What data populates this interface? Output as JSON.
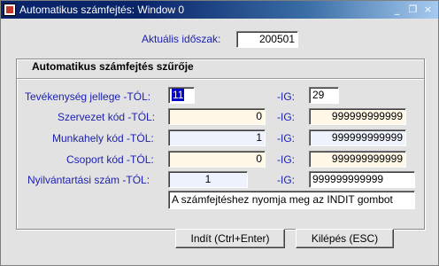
{
  "window": {
    "title": "Automatikus számfejtés: Window 0",
    "buttons": {
      "minimize": "_",
      "restore": "❐",
      "close": "×"
    }
  },
  "period": {
    "label": "Aktuális időszak:",
    "value": "200501"
  },
  "filter": {
    "title": "Automatikus számfejtés szűrője",
    "to_label": "-IG:",
    "rows": [
      {
        "label": "Tevékenység jellege -TÓL:",
        "from": "11",
        "to": "29"
      },
      {
        "label": "Szervezet kód -TÓL:",
        "from": "0",
        "to": "999999999999"
      },
      {
        "label": "Munkahely kód -TÓL:",
        "from": "1",
        "to": "999999999999"
      },
      {
        "label": "Csoport kód -TÓL:",
        "from": "0",
        "to": "999999999999"
      },
      {
        "label": "Nyilvántartási szám -TÓL:",
        "from": "1",
        "to": "999999999999"
      }
    ],
    "message": "A számfejtéshez nyomja meg az INDIT gombot"
  },
  "buttons": {
    "start": "Indít (Ctrl+Enter)",
    "exit": "Kilépés (ESC)"
  }
}
